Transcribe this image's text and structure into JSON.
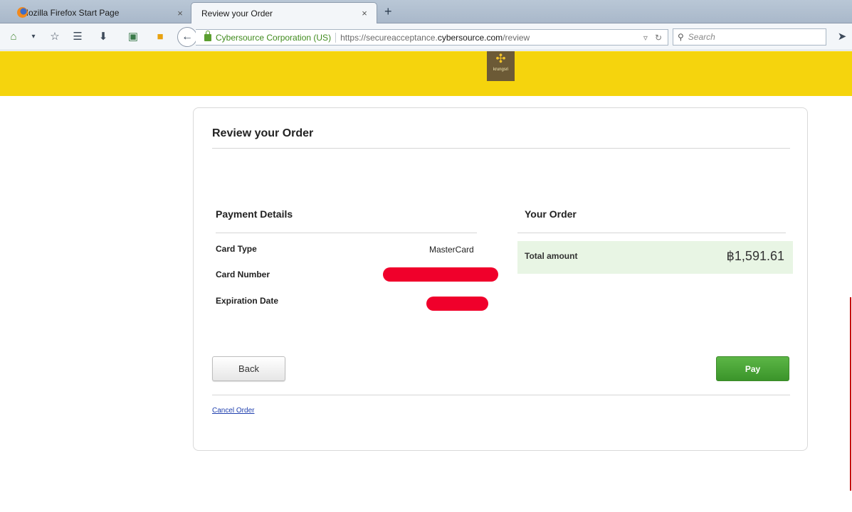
{
  "browser": {
    "tabs": [
      {
        "label": "Mozilla Firefox Start Page",
        "active": false
      },
      {
        "label": "Review your Order",
        "active": true
      }
    ],
    "new_tab": "+",
    "tab_close": "×",
    "back_icon": "←",
    "site_identity": "Cybersource Corporation (US)",
    "url_prefix": "https://secureacceptance.",
    "url_domain": "cybersource.com",
    "url_path": "/review",
    "search_placeholder": "Search"
  },
  "brand": {
    "logo_text": "krungsri",
    "accent_color": "#f5d40d"
  },
  "page": {
    "title": "Review your Order",
    "payment": {
      "heading": "Payment Details",
      "rows": [
        {
          "label": "Card Type",
          "value": "MasterCard"
        },
        {
          "label": "Card Number",
          "value": ""
        },
        {
          "label": "Expiration Date",
          "value": ""
        }
      ]
    },
    "order": {
      "heading": "Your Order",
      "total_label": "Total amount",
      "total_value": "฿1,591.61"
    },
    "buttons": {
      "back": "Back",
      "pay": "Pay"
    },
    "cancel_link": "Cancel Order"
  }
}
